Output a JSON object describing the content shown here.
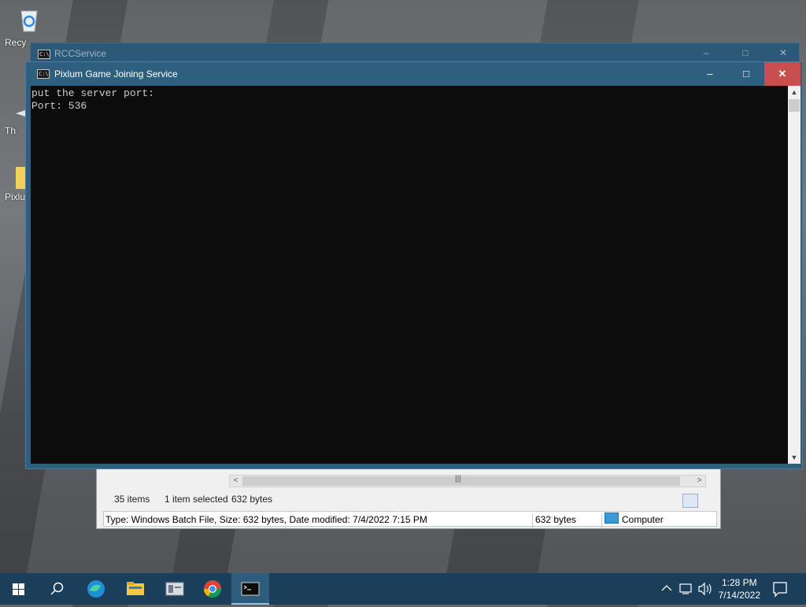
{
  "desktop": {
    "icons": [
      {
        "label": "Recy"
      },
      {
        "label": "Th"
      },
      {
        "label": "Pixlun"
      }
    ]
  },
  "explorer": {
    "status": {
      "item_count": "35 items",
      "selected": "1 item selected",
      "size": "632 bytes"
    },
    "details": {
      "info": "Type: Windows Batch File, Size: 632 bytes, Date modified: 7/4/2022 7:15 PM",
      "size": "632 bytes",
      "location": "Computer"
    },
    "scroll_thumb_glyph": "|||"
  },
  "back_window": {
    "title": "RCCService",
    "controls": {
      "minimize": "–",
      "maximize": "□",
      "close": "✕"
    }
  },
  "console": {
    "title": "Pixlum Game Joining Service",
    "controls": {
      "minimize": "–",
      "maximize": "□",
      "close": "✕"
    },
    "output": "put the server port:\nPort: 536"
  },
  "taskbar": {
    "clock_time": "1:28 PM",
    "clock_date": "7/14/2022",
    "accent": "#1b3f5a"
  },
  "colors": {
    "titlebar": "#2e5f7e",
    "close_button": "#c94f4f",
    "console_bg": "#0c0c0c",
    "console_text": "#cccccc"
  }
}
